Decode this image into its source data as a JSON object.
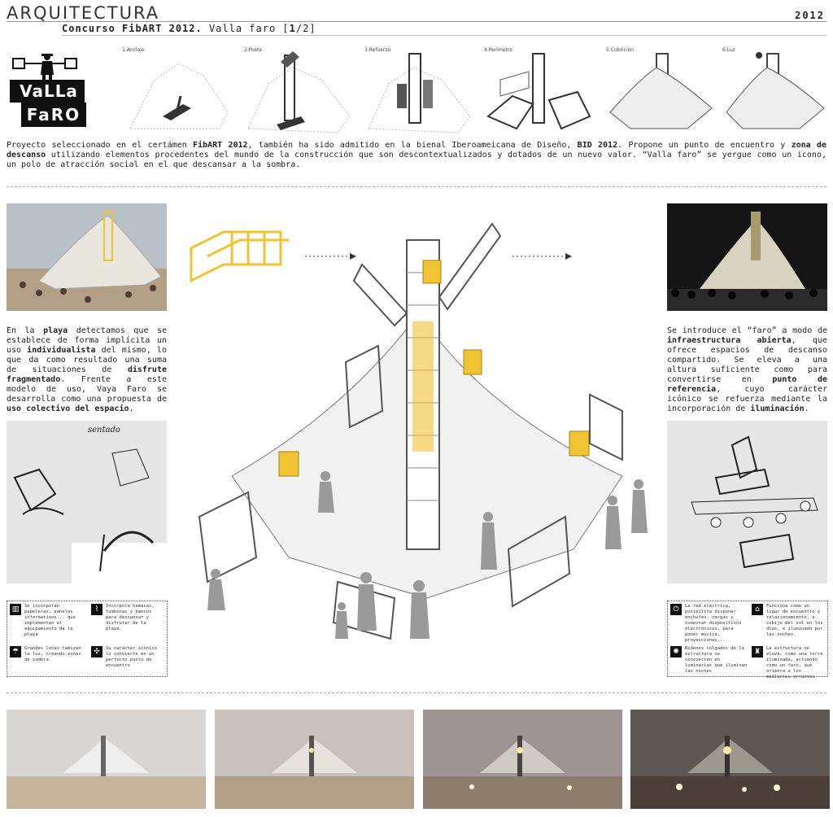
{
  "header": {
    "title": "ARQUITECTURA",
    "year": "2012",
    "subtitle_bold": "Concurso FibART 2012.",
    "subtitle_rest": " Valla faro [",
    "subtitle_page": "1",
    "subtitle_end": "/2]"
  },
  "logo": {
    "line1": "VaLLa",
    "line2": "FaRO"
  },
  "steps": [
    {
      "label": "1.Anclaje"
    },
    {
      "label": "2.Poste"
    },
    {
      "label": "3.Refuerzo"
    },
    {
      "label": "4.Perímetro"
    },
    {
      "label": "5.Cubrición"
    },
    {
      "label": "6.Luz"
    }
  ],
  "intro": {
    "p1": "Proyecto seleccionado en el certámen ",
    "b1": "FibART 2012",
    "p2": ", también ha sido admitido en la bienal Iberoameicana de Diseño, ",
    "b2": "BID 2012",
    "p3": ". Propone un punto de encuentro y ",
    "b3": "zona de descanso",
    "p4": " utilizando elementos procedentes  del mundo de la construcción que son descontextualizados y dotados de un nuevo valor. “Valla faro”  se yergue como un icono, un polo de atracción social en el que descansar a la sombra."
  },
  "left_text": {
    "t1": "En la ",
    "b1": "playa",
    "t2": " detectamos que se establece de forma implícita un uso ",
    "b2": "individualista",
    "t3": " del mismo, lo que da como resultado una suma de situaciones de ",
    "b3": "disfrute fragmentado",
    "t4": ". Frente a este modelo de uso, Vaya Faro se desarrolla como una propuesta de ",
    "b4": "uso colectivo del espacio",
    "t5": "."
  },
  "right_text": {
    "t1": "Se introduce el “faro” a modo de ",
    "b1": "infraestructura abierta",
    "t2": ", que ofrece espacios de descanso compartido. Se eleva a una altura suficiente como para convertirse en ",
    "b2": "punto de referencia",
    "t3": ", cuyo carácter icónico se refuerza mediante la incorporación de ",
    "b3": "iluminación",
    "t4": "."
  },
  "sketch_word": "sentado",
  "notes_left": [
    {
      "icon": "trash-icon",
      "text": "Se incorporan papeleras, paneles informativos... que implementan el equipamiento de la playa"
    },
    {
      "icon": "hammock-icon",
      "text": "Incorpora hamacas, tumbonas y bancos para descansar y disfrutar de la playa."
    },
    {
      "icon": "umbrella-icon",
      "text": "Grandes lonas tamizan la luz, creando zonas de sombra"
    },
    {
      "icon": "meeting-icon",
      "text": "Su carácter icónico lo convierte en un perfecto punto de encuentro"
    }
  ],
  "notes_right": [
    {
      "icon": "plug-icon",
      "text": "La red eléctrica, posibilita disponer enchufes, cargas y conectar dispositivos electrónicos, para poner música, proyecciones..."
    },
    {
      "icon": "home-icon",
      "text": "Funciona como un lugar de encuentro y relacionamiento, a cobijo del sol en los días, e iluminado por las noches."
    },
    {
      "icon": "bulb-icon",
      "text": "Bidones colgados de la estructura se convierten en luminarias que iluminan las noches"
    },
    {
      "icon": "tower-icon",
      "text": "La estructura se eleva, como una torre iluminada, actuando como un faro, que orienta a los mediantes errantes"
    }
  ],
  "colors": {
    "accent": "#f1c232",
    "dark": "#222222"
  },
  "bottom_photos": [
    {
      "sky": "#d9d6d4"
    },
    {
      "sky": "#c9c1bc"
    },
    {
      "sky": "#9c9593"
    },
    {
      "sky": "#5d5754"
    }
  ]
}
